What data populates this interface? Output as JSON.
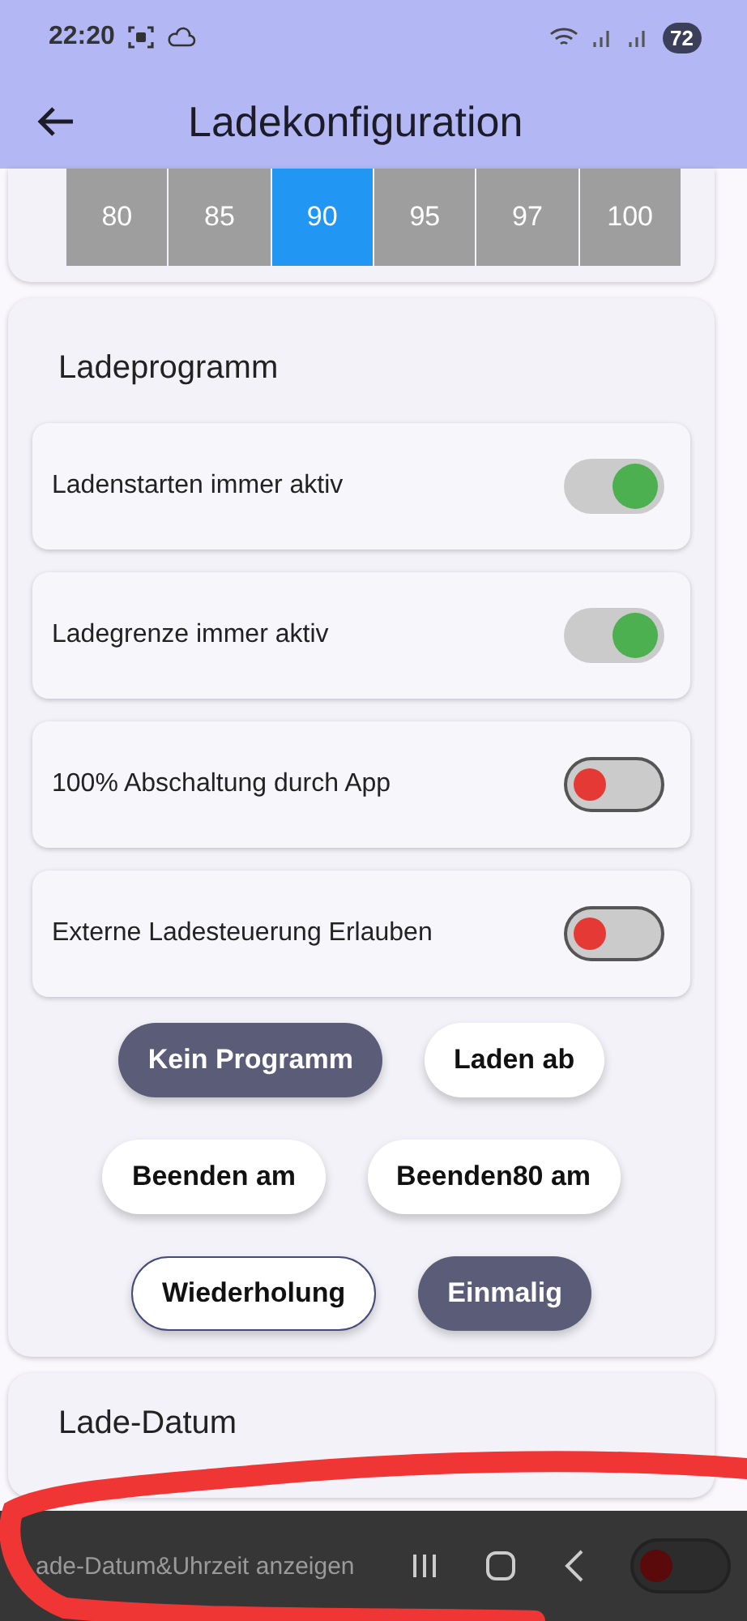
{
  "status_bar": {
    "time": "22:20",
    "battery": "72"
  },
  "app_bar": {
    "title": "Ladekonfiguration"
  },
  "limit_segments": [
    {
      "label": "80",
      "selected": false
    },
    {
      "label": "85",
      "selected": false
    },
    {
      "label": "90",
      "selected": true
    },
    {
      "label": "95",
      "selected": false
    },
    {
      "label": "97",
      "selected": false
    },
    {
      "label": "100",
      "selected": false
    }
  ],
  "program_card": {
    "title": "Ladeprogramm",
    "toggles": [
      {
        "label": "Ladenstarten immer aktiv",
        "on": true
      },
      {
        "label": "Ladegrenze immer aktiv",
        "on": true
      },
      {
        "label": "100% Abschaltung durch App",
        "on": false
      },
      {
        "label": "Externe Ladesteuerung Erlauben",
        "on": false
      }
    ],
    "chip_rows": [
      [
        {
          "label": "Kein Programm",
          "selected": true,
          "outlined": false
        },
        {
          "label": "Laden ab",
          "selected": false,
          "outlined": false
        }
      ],
      [
        {
          "label": "Beenden am",
          "selected": false,
          "outlined": false
        },
        {
          "label": "Beenden80 am",
          "selected": false,
          "outlined": false
        }
      ],
      [
        {
          "label": "Wiederholung",
          "selected": false,
          "outlined": true
        },
        {
          "label": "Einmalig",
          "selected": true,
          "outlined": false
        }
      ]
    ]
  },
  "date_card": {
    "title": "Lade-Datum",
    "row": {
      "label": "ade-Datum&Uhrzeit anzeigen",
      "on": false
    }
  }
}
